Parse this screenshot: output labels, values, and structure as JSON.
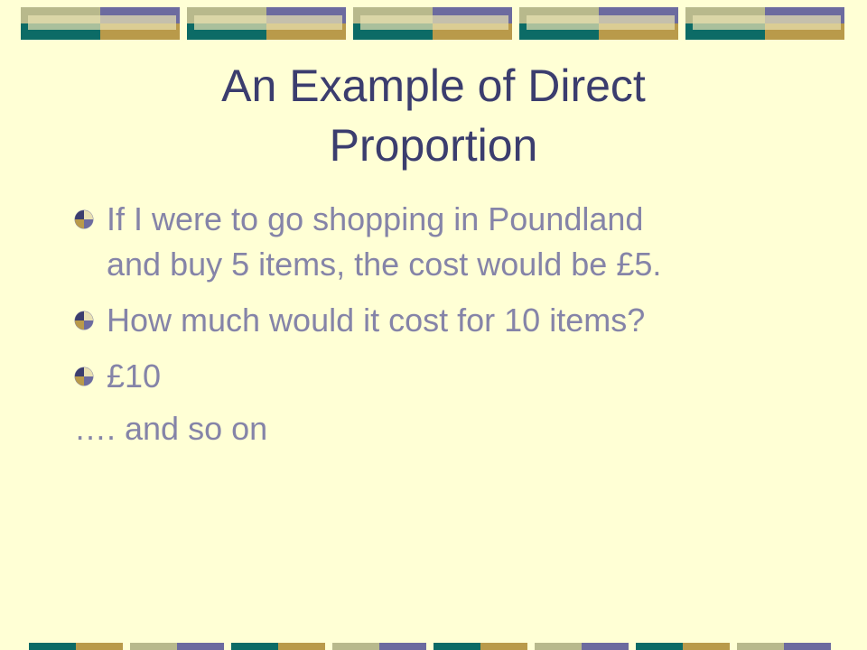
{
  "slide": {
    "title_line1": "An Example of Direct",
    "title_line2": "Proportion",
    "bullets": [
      {
        "line1": "If I were to go shopping in Poundland",
        "line2": "and buy 5 items, the cost would be £5."
      },
      {
        "line1": "How much would it cost for 10 items?"
      },
      {
        "line1": "£10"
      }
    ],
    "trailing_text": "…. and so on"
  },
  "colors": {
    "background": "#ffffd5",
    "title": "#3b3d6e",
    "body_text": "#8584a8",
    "teal": "#0c6b66",
    "gold": "#b99a4a",
    "olive": "#b8b98c",
    "purple": "#6c6b9f"
  },
  "icons": {
    "bullet": "quartered-circle-bullet-icon"
  }
}
